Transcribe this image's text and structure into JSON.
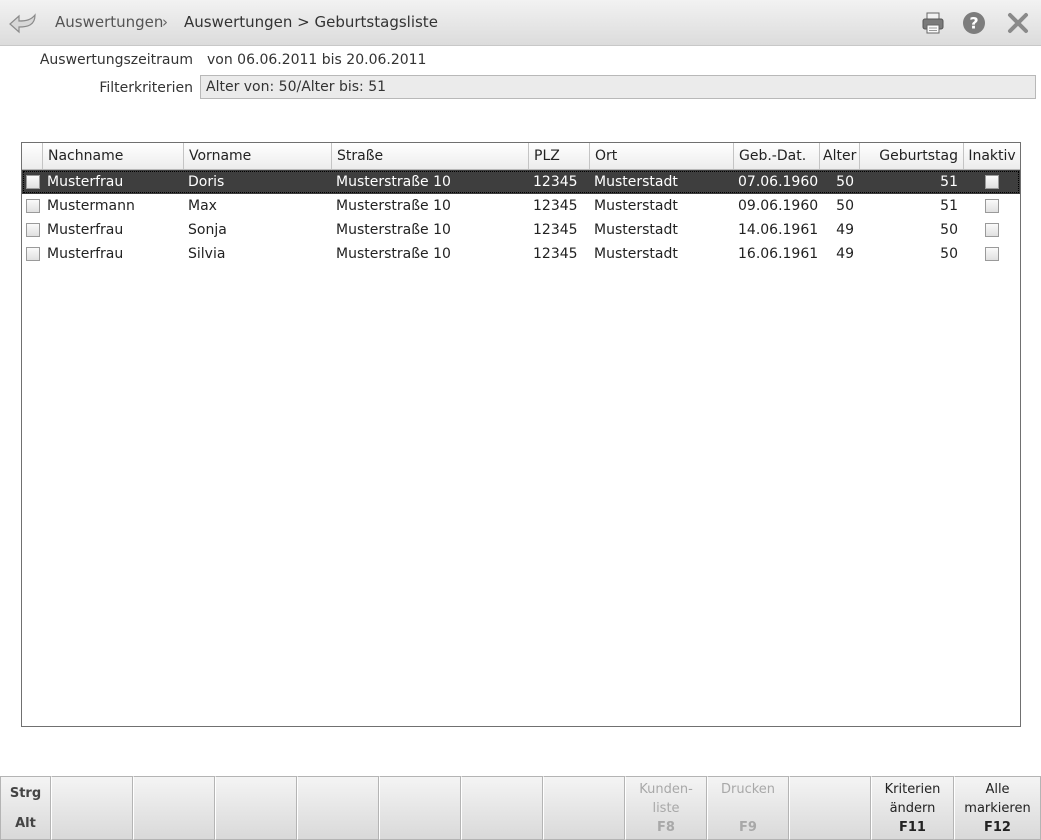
{
  "header": {
    "breadcrumb_root": "Auswertungen",
    "breadcrumb_separator": "›",
    "breadcrumb_current": "Auswertungen > Geburtstagsliste",
    "icons": [
      "back-arrow-icon",
      "printer-icon",
      "help-icon",
      "close-icon"
    ]
  },
  "info": {
    "period_label": "Auswertungszeitraum",
    "period_value": "von 06.06.2011 bis 20.06.2011",
    "filter_label": "Filterkriterien",
    "filter_value": "Alter von: 50/Alter bis: 51"
  },
  "table": {
    "columns": {
      "nachname": "Nachname",
      "vorname": "Vorname",
      "strasse": "Straße",
      "plz": "PLZ",
      "ort": "Ort",
      "gebdat": "Geb.-Dat.",
      "alter": "Alter",
      "geburtstag": "Geburtstag",
      "inaktiv": "Inaktiv"
    },
    "rows": [
      {
        "nachname": "Musterfrau",
        "vorname": "Doris",
        "strasse": "Musterstraße 10",
        "plz": "12345",
        "ort": "Musterstadt",
        "gebdat": "07.06.1960",
        "alter": "50",
        "geburtstag": "51",
        "selected": true
      },
      {
        "nachname": "Mustermann",
        "vorname": "Max",
        "strasse": "Musterstraße 10",
        "plz": "12345",
        "ort": "Musterstadt",
        "gebdat": "09.06.1960",
        "alter": "50",
        "geburtstag": "51",
        "selected": false
      },
      {
        "nachname": "Musterfrau",
        "vorname": "Sonja",
        "strasse": "Musterstraße 10",
        "plz": "12345",
        "ort": "Musterstadt",
        "gebdat": "14.06.1961",
        "alter": "49",
        "geburtstag": "50",
        "selected": false
      },
      {
        "nachname": "Musterfrau",
        "vorname": "Silvia",
        "strasse": "Musterstraße 10",
        "plz": "12345",
        "ort": "Musterstadt",
        "gebdat": "16.06.1961",
        "alter": "49",
        "geburtstag": "50",
        "selected": false
      }
    ]
  },
  "fkeys": {
    "modifier_top": "Strg",
    "modifier_bottom": "Alt",
    "f8_label_1": "Kunden-",
    "f8_label_2": "liste",
    "f8_key": "F8",
    "f9_label": "Drucken",
    "f9_key": "F9",
    "f11_label_1": "Kriterien",
    "f11_label_2": "ändern",
    "f11_key": "F11",
    "f12_label_1": "Alle",
    "f12_label_2": "markieren",
    "f12_key": "F12"
  }
}
